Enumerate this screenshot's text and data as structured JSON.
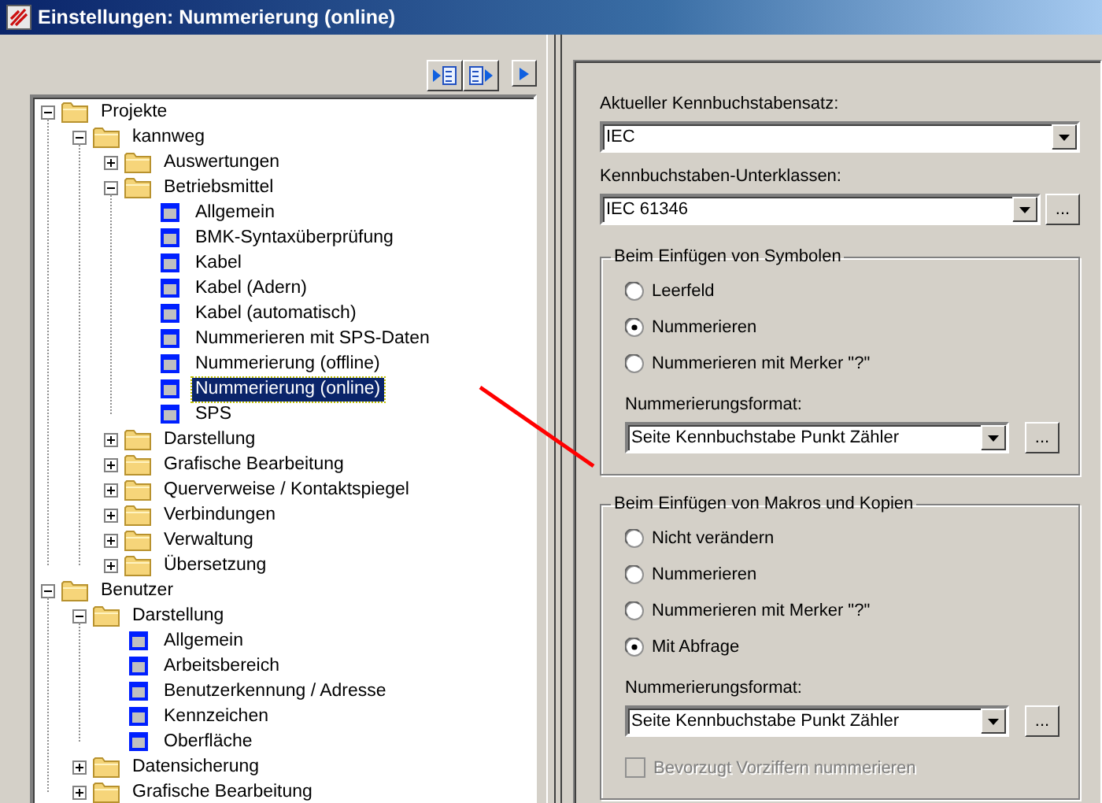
{
  "window": {
    "title": "Einstellungen: Nummerierung (online)"
  },
  "toolbar": [
    {
      "kind": "triangle-page"
    },
    {
      "kind": "page-triangle"
    },
    {
      "kind": "triangle"
    }
  ],
  "tree": [
    {
      "label": "Projekte",
      "kind": "folder",
      "expanded": true,
      "selected": false,
      "children": [
        {
          "label": "kannweg",
          "kind": "folder",
          "expanded": true,
          "selected": false,
          "children": [
            {
              "label": "Auswertungen",
              "kind": "folder",
              "expanded": false,
              "selected": false
            },
            {
              "label": "Betriebsmittel",
              "kind": "folder",
              "expanded": true,
              "selected": false,
              "children": [
                {
                  "label": "Allgemein",
                  "kind": "page",
                  "selected": false
                },
                {
                  "label": "BMK-Syntaxüberprüfung",
                  "kind": "page",
                  "selected": false
                },
                {
                  "label": "Kabel",
                  "kind": "page",
                  "selected": false
                },
                {
                  "label": "Kabel (Adern)",
                  "kind": "page",
                  "selected": false
                },
                {
                  "label": "Kabel (automatisch)",
                  "kind": "page",
                  "selected": false
                },
                {
                  "label": "Nummerieren mit SPS-Daten",
                  "kind": "page",
                  "selected": false
                },
                {
                  "label": "Nummerierung (offline)",
                  "kind": "page",
                  "selected": false
                },
                {
                  "label": "Nummerierung (online)",
                  "kind": "page",
                  "selected": true
                },
                {
                  "label": "SPS",
                  "kind": "page",
                  "selected": false
                }
              ]
            },
            {
              "label": "Darstellung",
              "kind": "folder",
              "expanded": false,
              "selected": false
            },
            {
              "label": "Grafische Bearbeitung",
              "kind": "folder",
              "expanded": false,
              "selected": false
            },
            {
              "label": "Querverweise / Kontaktspiegel",
              "kind": "folder",
              "expanded": false,
              "selected": false
            },
            {
              "label": "Verbindungen",
              "kind": "folder",
              "expanded": false,
              "selected": false
            },
            {
              "label": "Verwaltung",
              "kind": "folder",
              "expanded": false,
              "selected": false
            },
            {
              "label": "Übersetzung",
              "kind": "folder",
              "expanded": false,
              "selected": false
            }
          ]
        }
      ]
    },
    {
      "label": "Benutzer",
      "kind": "folder",
      "expanded": true,
      "selected": false,
      "children": [
        {
          "label": "Darstellung",
          "kind": "folder",
          "expanded": true,
          "selected": false,
          "children": [
            {
              "label": "Allgemein",
              "kind": "page",
              "selected": false
            },
            {
              "label": "Arbeitsbereich",
              "kind": "page",
              "selected": false
            },
            {
              "label": "Benutzerkennung / Adresse",
              "kind": "page",
              "selected": false
            },
            {
              "label": "Kennzeichen",
              "kind": "page",
              "selected": false
            },
            {
              "label": "Oberfläche",
              "kind": "page",
              "selected": false
            }
          ]
        },
        {
          "label": "Datensicherung",
          "kind": "folder",
          "expanded": false,
          "selected": false
        },
        {
          "label": "Grafische Bearbeitung",
          "kind": "folder",
          "expanded": false,
          "selected": false
        }
      ]
    }
  ],
  "settings": {
    "fields": [
      {
        "label": "Aktueller Kennbuchstabensatz:",
        "value": "IEC"
      },
      {
        "label": "Kennbuchstaben-Unterklassen:",
        "value": "IEC 61346",
        "browse_button": "..."
      }
    ],
    "groups": [
      {
        "title": "Beim Einfügen von Symbolen",
        "options": [
          {
            "label": "Leerfeld",
            "selected": false
          },
          {
            "label": "Nummerieren",
            "selected": true
          },
          {
            "label": "Nummerieren mit Merker \"?\"",
            "selected": false
          }
        ],
        "format": {
          "label": "Nummerierungsformat:",
          "value": "Seite Kennbuchstabe Punkt Zähler",
          "browse_button": "..."
        }
      },
      {
        "title": "Beim Einfügen von Makros und Kopien",
        "options": [
          {
            "label": "Nicht verändern",
            "selected": false
          },
          {
            "label": "Nummerieren",
            "selected": false
          },
          {
            "label": "Nummerieren mit Merker \"?\"",
            "selected": false
          },
          {
            "label": "Mit Abfrage",
            "selected": true
          }
        ],
        "format": {
          "label": "Nummerierungsformat:",
          "value": "Seite Kennbuchstabe Punkt Zähler",
          "browse_button": "..."
        },
        "checkbox": {
          "label": "Bevorzugt Vorziffern nummerieren",
          "checked": false,
          "disabled": true
        }
      }
    ]
  }
}
